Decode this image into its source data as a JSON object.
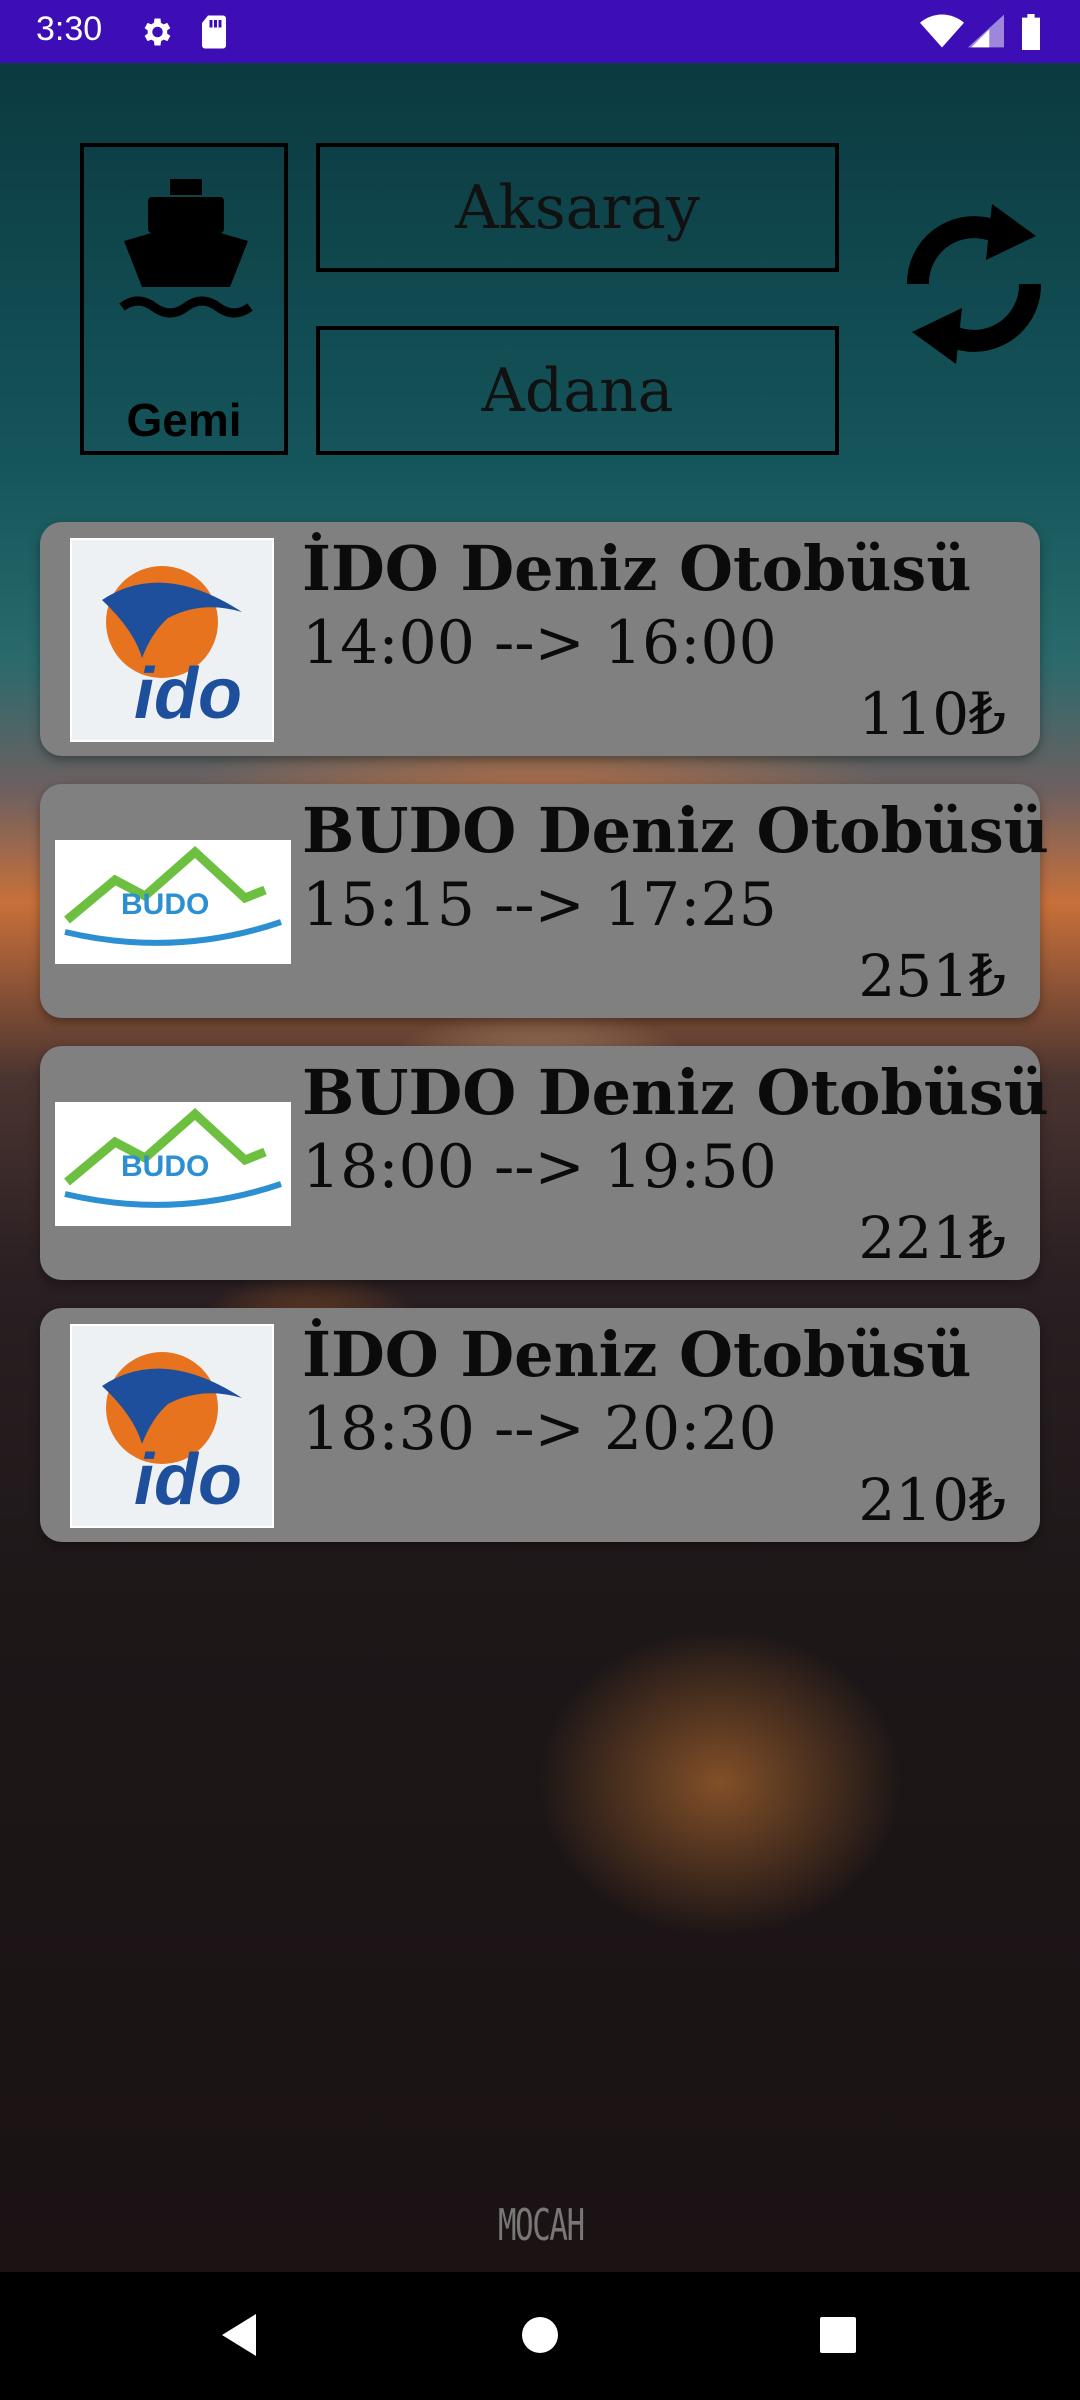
{
  "status_bar": {
    "time": "3:30",
    "icons": [
      "gear-icon",
      "sd-card-icon",
      "wifi-icon",
      "signal-icon",
      "battery-icon"
    ]
  },
  "transport_mode": {
    "icon": "ship-icon",
    "label": "Gemi"
  },
  "route": {
    "from": "Aksaray",
    "to": "Adana",
    "swap_icon": "refresh-icon"
  },
  "trips": [
    {
      "company": "İDO Deniz Otobüsü",
      "logo": "ido-logo",
      "logo_text": "ido",
      "time": "14:00 --> 16:00",
      "price": "110₺"
    },
    {
      "company": "BUDO Deniz Otobüsü",
      "logo": "budo-logo",
      "logo_text": "BUDO",
      "time": "15:15 --> 17:25",
      "price": "251₺"
    },
    {
      "company": "BUDO Deniz Otobüsü",
      "logo": "budo-logo",
      "logo_text": "BUDO",
      "time": "18:00 --> 19:50",
      "price": "221₺"
    },
    {
      "company": "İDO Deniz Otobüsü",
      "logo": "ido-logo",
      "logo_text": "ido",
      "time": "18:30 --> 20:20",
      "price": "210₺"
    }
  ],
  "background": {
    "watermark": "MOCAH"
  },
  "colors": {
    "status_bar": "#3d0eb5",
    "card": "#808080",
    "ido_orange": "#e8731e",
    "ido_blue": "#1e4f9c",
    "budo_green": "#6cbf3f",
    "budo_blue": "#2c8fd1"
  },
  "navigation": [
    "back-icon",
    "home-icon",
    "recents-icon"
  ]
}
